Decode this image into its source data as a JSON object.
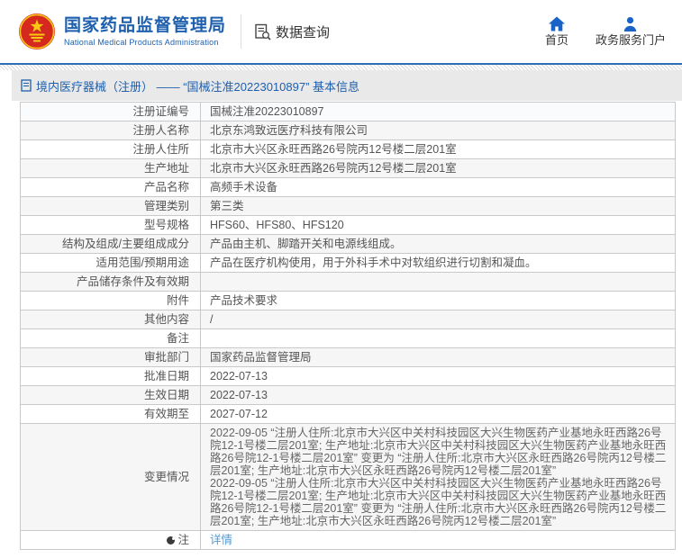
{
  "header": {
    "org_name_zh": "国家药品监督管理局",
    "org_name_en": "National Medical Products Administration",
    "data_query_label": "数据查询",
    "nav": [
      {
        "label": "首页"
      },
      {
        "label": "政务服务门户"
      }
    ]
  },
  "breadcrumb": {
    "text": "境内医疗器械（注册） —— “国械注准20223010897” 基本信息"
  },
  "table": {
    "rows": [
      {
        "label": "注册证编号",
        "value": "国械注准20223010897"
      },
      {
        "label": "注册人名称",
        "value": "北京东鸿致远医疗科技有限公司"
      },
      {
        "label": "注册人住所",
        "value": "北京市大兴区永旺西路26号院丙12号楼二层201室"
      },
      {
        "label": "生产地址",
        "value": "北京市大兴区永旺西路26号院丙12号楼二层201室"
      },
      {
        "label": "产品名称",
        "value": "高频手术设备"
      },
      {
        "label": "管理类别",
        "value": "第三类"
      },
      {
        "label": "型号规格",
        "value": "HFS60、HFS80、HFS120"
      },
      {
        "label": "结构及组成/主要组成成分",
        "value": "产品由主机、脚踏开关和电源线组成。"
      },
      {
        "label": "适用范围/预期用途",
        "value": "产品在医疗机构使用，用于外科手术中对软组织进行切割和凝血。"
      },
      {
        "label": "产品储存条件及有效期",
        "value": ""
      },
      {
        "label": "附件",
        "value": "产品技术要求"
      },
      {
        "label": "其他内容",
        "value": "/"
      },
      {
        "label": "备注",
        "value": ""
      },
      {
        "label": "审批部门",
        "value": "国家药品监督管理局"
      },
      {
        "label": "批准日期",
        "value": "2022-07-13"
      },
      {
        "label": "生效日期",
        "value": "2022-07-13"
      },
      {
        "label": "有效期至",
        "value": "2027-07-12"
      },
      {
        "label": "变更情况",
        "value": [
          "2022-09-05  “注册人住所:北京市大兴区中关村科技园区大兴生物医药产业基地永旺西路26号院12-1号楼二层201室; 生产地址:北京市大兴区中关村科技园区大兴生物医药产业基地永旺西路26号院12-1号楼二层201室” 变更为 “注册人住所:北京市大兴区永旺西路26号院丙12号楼二层201室; 生产地址:北京市大兴区永旺西路26号院丙12号楼二层201室”",
          "2022-09-05  “注册人住所:北京市大兴区中关村科技园区大兴生物医药产业基地永旺西路26号院12-1号楼二层201室; 生产地址:北京市大兴区中关村科技园区大兴生物医药产业基地永旺西路26号院12-1号楼二层201室” 变更为 “注册人住所:北京市大兴区永旺西路26号院丙12号楼二层201室; 生产地址:北京市大兴区永旺西路26号院丙12号楼二层201室”"
        ]
      },
      {
        "label": "注",
        "value": "详情",
        "link": true,
        "icon": "note-circle-icon"
      }
    ]
  },
  "colors": {
    "accent_blue": "#1e5fae",
    "icon_blue": "#1a63c6",
    "divider_blue": "#2e6cb4",
    "breadcrumb_band_gray": "#e9e9e9",
    "link_blue": "#4e9ad6",
    "row_shade_gray": "#f6f6f7",
    "row_shade_first": "#fafbfd",
    "table_border_gray": "#c9c9c9",
    "emblem_red": "#d5281e",
    "emblem_gold": "#f8c812"
  }
}
